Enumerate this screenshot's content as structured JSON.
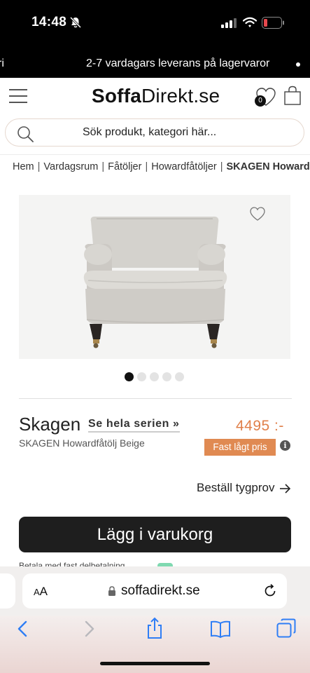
{
  "status_bar": {
    "time": "14:48",
    "icons": [
      "bell-slash-icon",
      "signal-icon",
      "wifi-icon",
      "battery-low-icon"
    ],
    "battery_color": "#e5484d"
  },
  "promo_bar": {
    "left_fragment": "ri",
    "text": "2-7 vardagars leverans på lagervaror"
  },
  "header": {
    "logo_part1": "Soffa",
    "logo_part2": "Direkt.se",
    "wishlist_count": "0",
    "search_placeholder": "Sök produkt, kategori här..."
  },
  "breadcrumb": {
    "items": [
      "Hem",
      "Vardagsrum",
      "Fåtöljer",
      "Howardfåtöljer"
    ],
    "current": "SKAGEN Howardfåtölj Beige"
  },
  "gallery": {
    "image_alt": "beige howard armchair",
    "active_index": 0,
    "dot_count": 5
  },
  "product": {
    "name": "Skagen",
    "series_link": "Se hela serien »",
    "price": "4495 :-",
    "subtitle": "SKAGEN Howardfåtölj Beige",
    "price_badge": "Fast lågt pris",
    "info_symbol": "i",
    "order_sample": "Beställ tygprov",
    "add_to_cart": "Lägg i varukorg",
    "partial_text": "Betala med fast delbetalning",
    "accent_color": "#e0804a"
  },
  "browser": {
    "aa_big": "A",
    "aa_small": "A",
    "url": "soffadirekt.se",
    "toolbar_icons": [
      "back-icon",
      "forward-icon",
      "share-icon",
      "bookmarks-icon",
      "tabs-icon"
    ]
  }
}
